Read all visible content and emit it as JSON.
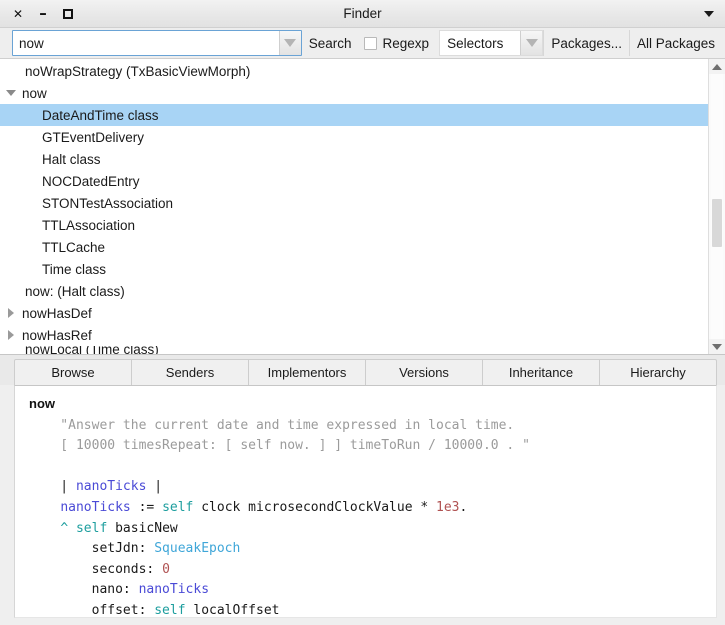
{
  "window": {
    "title": "Finder",
    "close_label": "✕",
    "minimize_label": "–",
    "maximize_label": "",
    "menu_icon": "chevron-down-icon"
  },
  "toolbar": {
    "search_value": "now",
    "search_placeholder": "",
    "search_button_label": "Search",
    "regexp_label": "Regexp",
    "regexp_checked": false,
    "scope_value": "Selectors",
    "packages_label": "Packages...",
    "all_packages_label": "All Packages"
  },
  "results": {
    "rows": [
      {
        "label": "noWrapStrategy (TxBasicViewMorph)",
        "indent": 1,
        "twisty": "none",
        "selected": false
      },
      {
        "label": "now",
        "indent": 0,
        "twisty": "open",
        "selected": false
      },
      {
        "label": "DateAndTime class",
        "indent": 2,
        "twisty": "none",
        "selected": true
      },
      {
        "label": "GTEventDelivery",
        "indent": 2,
        "twisty": "none",
        "selected": false
      },
      {
        "label": "Halt class",
        "indent": 2,
        "twisty": "none",
        "selected": false
      },
      {
        "label": "NOCDatedEntry",
        "indent": 2,
        "twisty": "none",
        "selected": false
      },
      {
        "label": "STONTestAssociation",
        "indent": 2,
        "twisty": "none",
        "selected": false
      },
      {
        "label": "TTLAssociation",
        "indent": 2,
        "twisty": "none",
        "selected": false
      },
      {
        "label": "TTLCache",
        "indent": 2,
        "twisty": "none",
        "selected": false
      },
      {
        "label": "Time class",
        "indent": 2,
        "twisty": "none",
        "selected": false
      },
      {
        "label": "now: (Halt class)",
        "indent": 1,
        "twisty": "none",
        "selected": false
      },
      {
        "label": "nowHasDef",
        "indent": 0,
        "twisty": "closed",
        "selected": false
      },
      {
        "label": "nowHasRef",
        "indent": 0,
        "twisty": "closed",
        "selected": false
      },
      {
        "label": "nowLocal (Time class)",
        "indent": 1,
        "twisty": "none",
        "selected": false,
        "clipped": true
      }
    ],
    "scrollbar": {
      "up_icon": "scroll-up-arrow-icon",
      "down_icon": "scroll-down-arrow-icon"
    }
  },
  "tabs": [
    {
      "label": "Browse"
    },
    {
      "label": "Senders"
    },
    {
      "label": "Implementors"
    },
    {
      "label": "Versions"
    },
    {
      "label": "Inheritance"
    },
    {
      "label": "Hierarchy"
    }
  ],
  "code": {
    "lines": [
      [
        {
          "t": "now",
          "c": "c-sel"
        }
      ],
      [
        {
          "t": "    \"Answer the current date and time expressed in local time.",
          "c": "c-cmt"
        }
      ],
      [
        {
          "t": "    [ 10000 timesRepeat: [ self now. ] ] timeToRun / 10000.0 . \"",
          "c": "c-cmt"
        }
      ],
      [
        {
          "t": "",
          "c": "c-plain"
        }
      ],
      [
        {
          "t": "    | ",
          "c": "c-plain"
        },
        {
          "t": "nanoTicks",
          "c": "c-var"
        },
        {
          "t": " |",
          "c": "c-plain"
        }
      ],
      [
        {
          "t": "    ",
          "c": "c-plain"
        },
        {
          "t": "nanoTicks",
          "c": "c-var"
        },
        {
          "t": " := ",
          "c": "c-plain"
        },
        {
          "t": "self",
          "c": "c-kw"
        },
        {
          "t": " clock microsecondClockValue * ",
          "c": "c-plain"
        },
        {
          "t": "1e3",
          "c": "c-num"
        },
        {
          "t": ".",
          "c": "c-plain"
        }
      ],
      [
        {
          "t": "    ",
          "c": "c-plain"
        },
        {
          "t": "^ ",
          "c": "c-ret"
        },
        {
          "t": "self",
          "c": "c-kw"
        },
        {
          "t": " basicNew",
          "c": "c-plain"
        }
      ],
      [
        {
          "t": "        setJdn: ",
          "c": "c-plain"
        },
        {
          "t": "SqueakEpoch",
          "c": "c-cls"
        }
      ],
      [
        {
          "t": "        seconds: ",
          "c": "c-plain"
        },
        {
          "t": "0",
          "c": "c-num"
        }
      ],
      [
        {
          "t": "        nano: ",
          "c": "c-plain"
        },
        {
          "t": "nanoTicks",
          "c": "c-var"
        }
      ],
      [
        {
          "t": "        offset: ",
          "c": "c-plain"
        },
        {
          "t": "self",
          "c": "c-kw"
        },
        {
          "t": " localOffset",
          "c": "c-plain"
        }
      ]
    ]
  }
}
